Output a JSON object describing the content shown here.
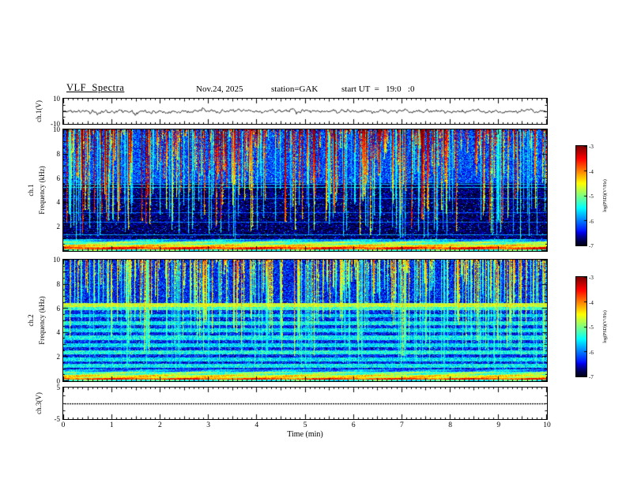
{
  "header": {
    "title": "VLF  Spectra",
    "date": "Nov.24, 2025",
    "station": "station=GAK",
    "start_ut": "start UT  =   19:0   :0"
  },
  "xaxis": {
    "label": "Time  (min)",
    "range": [
      0,
      10
    ],
    "major_ticks": [
      0,
      1,
      2,
      3,
      4,
      5,
      6,
      7,
      8,
      9,
      10
    ],
    "minor_tick_step": 0.1
  },
  "panels": {
    "ch1_wave": {
      "ylabel": "ch.1(V)",
      "ylim": [
        -10,
        10
      ],
      "yticks": [
        [
          10,
          "10"
        ],
        [
          -10,
          "-10"
        ]
      ]
    },
    "ch1_spec": {
      "ylabel_ch": "ch.1",
      "ylabel_freq": "Frequency  (kHz)",
      "ylim": [
        0,
        10
      ],
      "yticks": [
        [
          10,
          "10"
        ],
        [
          8,
          "8"
        ],
        [
          6,
          "6"
        ],
        [
          4,
          "4"
        ],
        [
          2,
          "2"
        ]
      ]
    },
    "ch2_spec": {
      "ylabel_ch": "ch.2",
      "ylabel_freq": "Frequency  (kHz)",
      "ylim": [
        0,
        10
      ],
      "yticks": [
        [
          10,
          "10"
        ],
        [
          8,
          "8"
        ],
        [
          6,
          "6"
        ],
        [
          4,
          "4"
        ],
        [
          2,
          "2"
        ],
        [
          0,
          "0"
        ]
      ]
    },
    "ch3_wave": {
      "ylabel": "ch.3(V)",
      "ylim": [
        -5,
        5
      ],
      "yticks": [
        [
          5,
          "5"
        ],
        [
          -5,
          "-5"
        ]
      ]
    }
  },
  "colorbar": {
    "label": "log(PSD)(V²/Hz)",
    "tick_labels": [
      "-3",
      "-4",
      "-5",
      "-6",
      "-7"
    ],
    "range": [
      -7,
      -3
    ]
  },
  "chart_data": [
    {
      "type": "line",
      "name": "ch1-voltage",
      "ylabel": "ch.1(V)",
      "ylim": [
        -10,
        10
      ],
      "x_range_min": [
        0,
        10
      ],
      "description": "Black broadband noise waveform centered on 0 V, peak-to-peak about 3 V with occasional larger spikes",
      "model": {
        "seed": 11,
        "amp": 1.9,
        "spike_prob": 0.006,
        "spike_amp": 3.6
      }
    },
    {
      "type": "heatmap",
      "name": "ch1-spectrogram",
      "ylabel": "Frequency (kHz)",
      "ylim": [
        0,
        10
      ],
      "x_range_min": [
        0,
        10
      ],
      "value_range": [
        -7,
        -3
      ],
      "description": "VLF power spectral density ch.1: bright red/orange band below 1 kHz, very dark 1-5.5 kHz background, blue 5.5-10 kHz with dense bright vertical sferic streaks reaching down from 10 kHz",
      "model": {
        "seed": 7,
        "stripes": [
          [
            0,
            0.12,
            -5.2
          ],
          [
            0.12,
            0.3,
            -3.7
          ],
          [
            0.3,
            0.5,
            -4.4
          ],
          [
            0.5,
            0.75,
            -5.0
          ],
          [
            0.75,
            1.0,
            -5.8
          ]
        ],
        "regions": [
          [
            1.0,
            5.6,
            -6.85,
            0.65,
            0.05,
            0.8
          ],
          [
            5.6,
            10,
            -6.25,
            0.6,
            0.1,
            0.7
          ]
        ],
        "hlines": [
          [
            5.25,
            -5.7
          ],
          [
            5.55,
            -5.8
          ],
          [
            2.4,
            -6.1
          ],
          [
            3.2,
            -6.15
          ],
          [
            4.35,
            -6.1
          ],
          [
            1.35,
            -5.9
          ]
        ],
        "streaks": {
          "count": 300,
          "min_f": 1.2,
          "pow": 1.6,
          "intensity": [
            -5.0,
            -3.6
          ],
          "top_boost": 1.2
        },
        "thin_streaks": {
          "count": 150,
          "min_f": 0.9,
          "pow": 0.3,
          "intensity": [
            -6.0,
            -5.4
          ],
          "top_boost": 0.3
        }
      }
    },
    {
      "type": "heatmap",
      "name": "ch2-spectrogram",
      "ylabel": "Frequency (kHz)",
      "ylim": [
        0,
        10
      ],
      "x_range_min": [
        0,
        10
      ],
      "value_range": [
        -7,
        -3
      ],
      "description": "VLF power spectral density ch.2: bright band below 1 kHz, cyan/green horizontal banding 1-5.5 kHz over blue background, strong yellow-green line near 6.3 kHz, blue upper region with vertical streaks",
      "model": {
        "seed": 23,
        "stripes": [
          [
            0,
            0.1,
            -5.3
          ],
          [
            0.1,
            0.28,
            -3.8
          ],
          [
            0.28,
            0.5,
            -4.5
          ],
          [
            0.5,
            0.8,
            -5.1
          ],
          [
            0.8,
            1.0,
            -5.9
          ]
        ],
        "regions": [
          [
            1.0,
            6.5,
            -6.4,
            0.6,
            0.08,
            0.7
          ],
          [
            6.5,
            10,
            -6.4,
            0.55,
            0.08,
            0.6
          ]
        ],
        "hlines": [],
        "bands": [
          [
            1.3,
            0.15,
            -5.5
          ],
          [
            1.8,
            0.12,
            -5.6
          ],
          [
            2.4,
            0.15,
            -5.4
          ],
          [
            3.0,
            0.12,
            -5.6
          ],
          [
            3.6,
            0.15,
            -5.5
          ],
          [
            4.2,
            0.12,
            -5.6
          ],
          [
            4.8,
            0.15,
            -5.5
          ],
          [
            5.4,
            0.1,
            -5.7
          ],
          [
            6.0,
            0.08,
            -5.3
          ],
          [
            6.3,
            0.1,
            -4.7
          ]
        ],
        "streaks": {
          "count": 230,
          "min_f": 2.0,
          "pow": 1.4,
          "intensity": [
            -5.6,
            -4.6
          ],
          "top_boost": 0.9
        },
        "thin_streaks": {
          "count": 120,
          "min_f": 0.9,
          "pow": 0.3,
          "intensity": [
            -5.9,
            -5.3
          ],
          "top_boost": 0.3
        }
      }
    },
    {
      "type": "line",
      "name": "ch3-voltage",
      "ylabel": "ch.3(V)",
      "ylim": [
        -5,
        5
      ],
      "x_range_min": [
        0,
        10
      ],
      "description": "Flat dotted trace constant at 0 V",
      "model": {
        "flat": true,
        "value": 0
      }
    }
  ]
}
